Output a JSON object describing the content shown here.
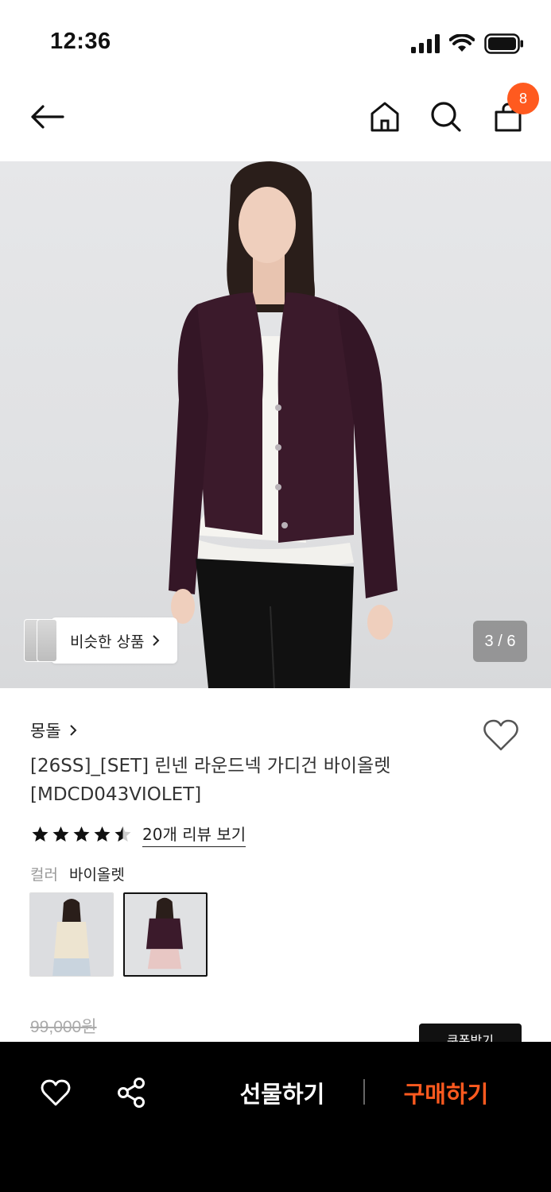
{
  "status_bar": {
    "time": "12:36"
  },
  "nav": {
    "cart_count": "8"
  },
  "hero": {
    "similar_label": "비슷한 상품",
    "page_indicator": "3 / 6"
  },
  "product": {
    "brand": "몽돌",
    "title_line1": "[26SS]_[SET] 린넨 라운드넥 가디건 바이올렛",
    "title_line2": "[MDCD043VIOLET]",
    "rating": 4.5,
    "review_link": "20개 리뷰 보기",
    "color_label": "컬러",
    "color_value": "바이올렛",
    "swatches": [
      {
        "name": "아이보리",
        "selected": false
      },
      {
        "name": "바이올렛",
        "selected": true
      }
    ],
    "original_price": "99,000원",
    "coupon_label": "쿠폰받기"
  },
  "bottom_bar": {
    "gift_label": "선물하기",
    "buy_label": "구매하기"
  },
  "colors": {
    "accent": "#ff5a1f",
    "cardigan": "#3b1a2b",
    "bottom_bar_bg": "#000000"
  }
}
